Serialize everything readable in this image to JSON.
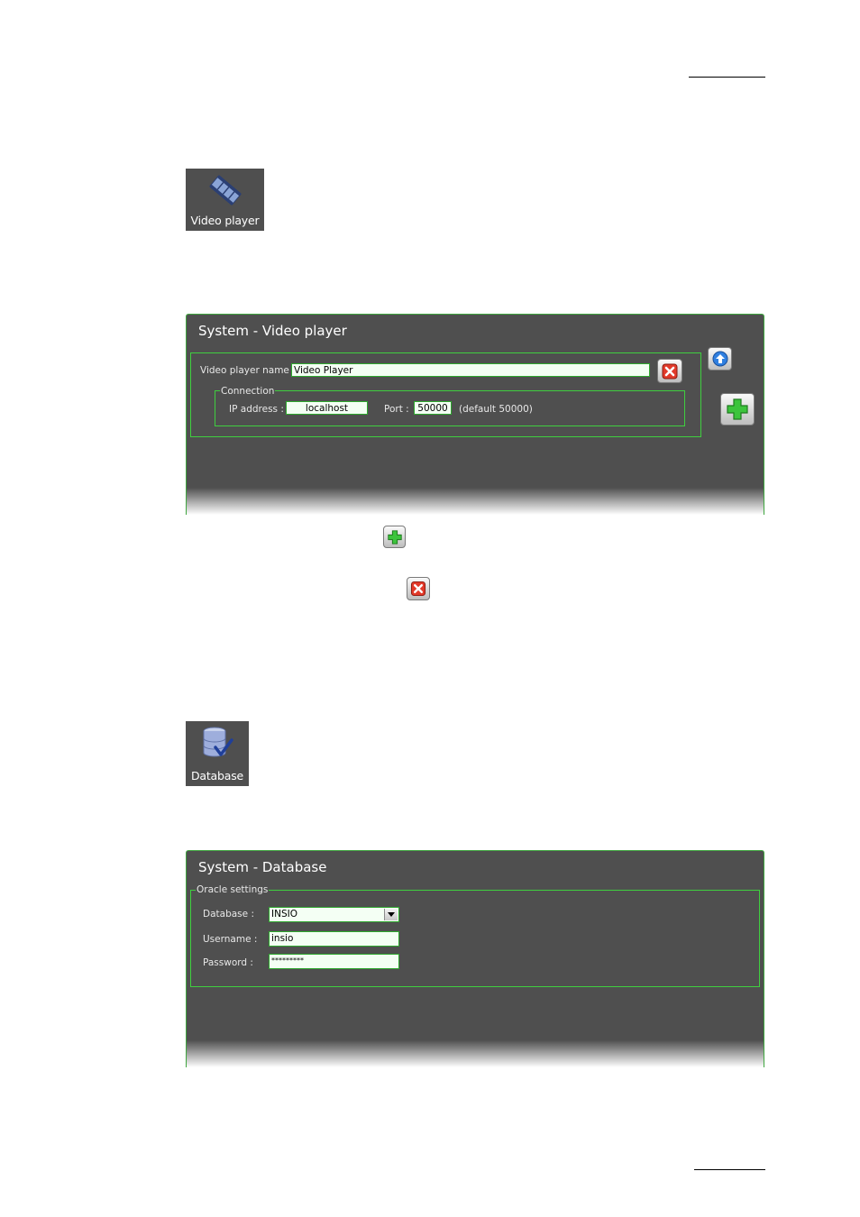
{
  "video_tile": {
    "label": "Video player",
    "icon": "film-strip-icon"
  },
  "video_panel": {
    "title": "System - Video player",
    "name_label": "Video player name :",
    "name_value": "Video Player",
    "connection_legend": "Connection",
    "ip_label": "IP address :",
    "ip_value": "localhost",
    "port_label": "Port :",
    "port_value": "50000",
    "port_hint": "(default 50000)"
  },
  "database_tile": {
    "label": "Database",
    "icon": "database-check-icon"
  },
  "database_panel": {
    "title": "System - Database",
    "oracle_legend": "Oracle settings",
    "database_label": "Database :",
    "database_value": "INSIO",
    "username_label": "Username :",
    "username_value": "insio",
    "password_label": "Password :",
    "password_value": "*********"
  },
  "colors": {
    "panel_bg": "#4f4f4f",
    "border_green": "#3fcf3f",
    "field_bg": "#f4fff4",
    "remove_red": "#e23a2a",
    "add_green": "#3cc43c",
    "up_blue": "#2f7fe0"
  }
}
